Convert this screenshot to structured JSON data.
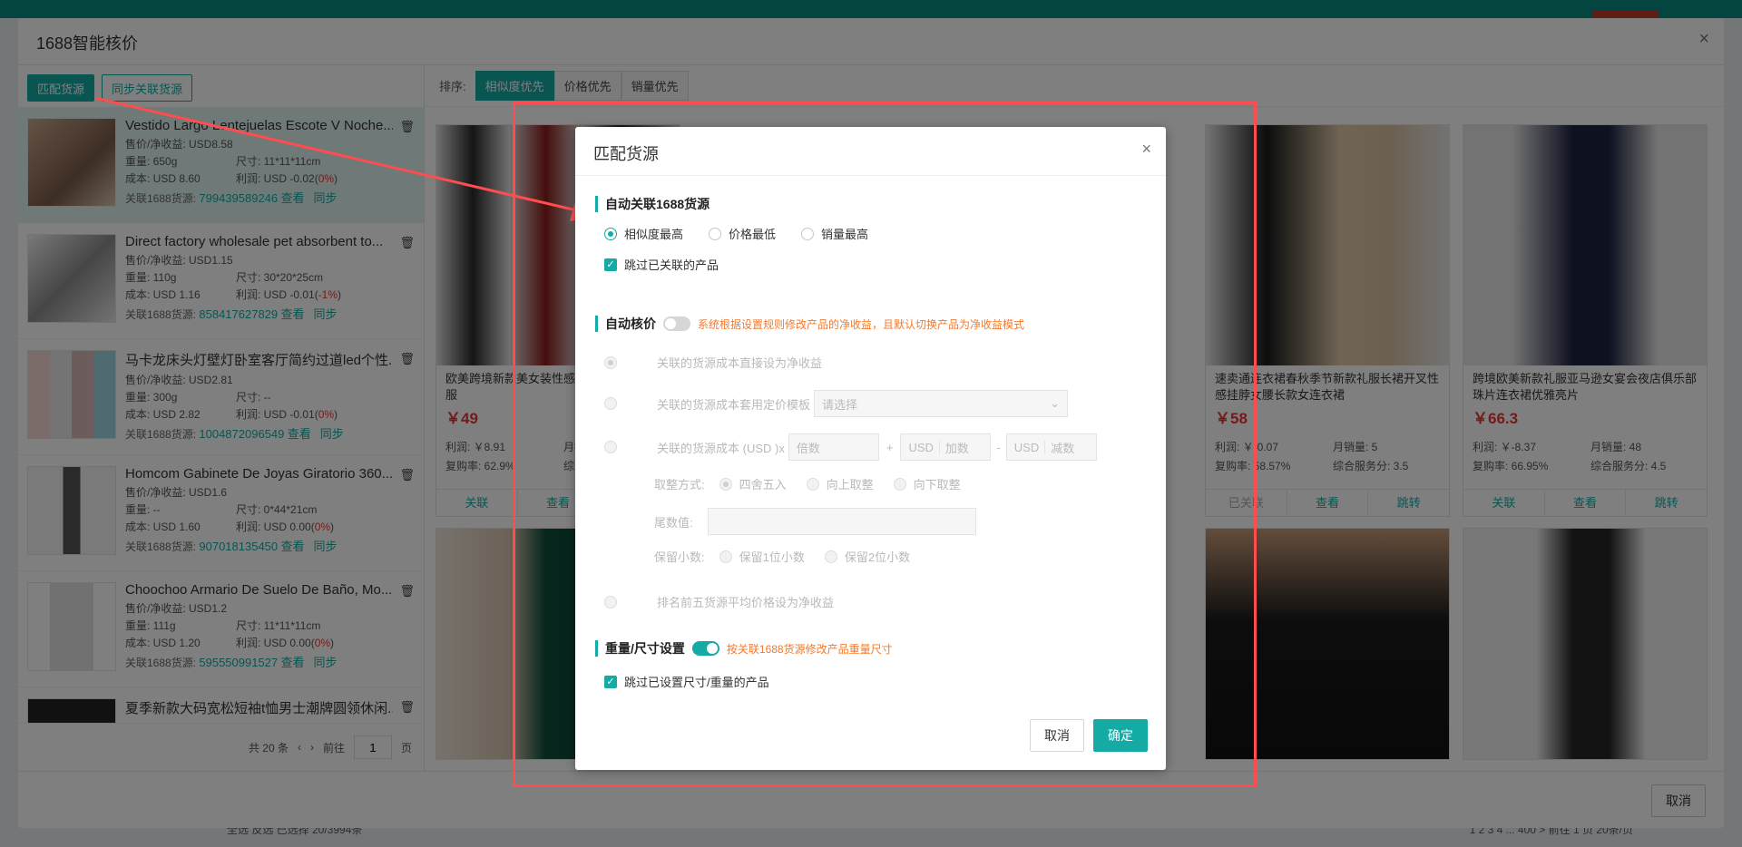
{
  "main": {
    "title": "1688智能核价",
    "buttons": {
      "match": "匹配货源",
      "sync": "同步关联货源"
    },
    "products": [
      {
        "title": "Vestido Largo Lentejuelas Escote V Noche...",
        "price": "售价/净收益:  USD8.58",
        "weight": "重量:  650g",
        "size": "尺寸:  11*11*11cm",
        "cost": "成本:  USD 8.60",
        "profit": "利润:  USD -0.02(",
        "pct": "0%",
        "close": ")",
        "link_label": "关联1688货源:",
        "link_id": "799439589246",
        "view": "查看",
        "sync": "同步"
      },
      {
        "title": "Direct factory wholesale pet absorbent to...",
        "price": "售价/净收益:  USD1.15",
        "weight": "重量:  110g",
        "size": "尺寸:  30*20*25cm",
        "cost": "成本:  USD 1.16",
        "profit": "利润:  USD -0.01(",
        "pct": "-1%",
        "close": ")",
        "link_label": "关联1688货源:",
        "link_id": "858417627829",
        "view": "查看",
        "sync": "同步"
      },
      {
        "title": "马卡龙床头灯壁灯卧室客厅简约过道led个性...",
        "price": "售价/净收益:  USD2.81",
        "weight": "重量:  300g",
        "size": "尺寸:  --",
        "cost": "成本:  USD 2.82",
        "profit": "利润:  USD -0.01(",
        "pct": "0%",
        "close": ")",
        "link_label": "关联1688货源:",
        "link_id": "1004872096549",
        "view": "查看",
        "sync": "同步"
      },
      {
        "title": "Homcom Gabinete De Joyas Giratorio 360...",
        "price": "售价/净收益:  USD1.6",
        "weight": "重量:  --",
        "size": "尺寸:  0*44*21cm",
        "cost": "成本:  USD 1.60",
        "profit": "利润:  USD 0.00(",
        "pct": "0%",
        "close": ")",
        "link_label": "关联1688货源:",
        "link_id": "907018135450",
        "view": "查看",
        "sync": "同步"
      },
      {
        "title": "Choochoo Armario De Suelo De Baño, Mo...",
        "price": "售价/净收益:  USD1.2",
        "weight": "重量:  111g",
        "size": "尺寸:  11*11*11cm",
        "cost": "成本:  USD 1.20",
        "profit": "利润:  USD 0.00(",
        "pct": "0%",
        "close": ")",
        "link_label": "关联1688货源:",
        "link_id": "595550991527",
        "view": "查看",
        "sync": "同步"
      },
      {
        "title": "夏季新款大码宽松短袖t恤男士潮牌圆领休闲...",
        "price": "",
        "weight": "",
        "size": "",
        "cost": "",
        "profit": "",
        "pct": "",
        "close": "",
        "link_label": "",
        "link_id": "",
        "view": "",
        "sync": ""
      }
    ],
    "pager": {
      "total": "共 20 条",
      "goto": "前往",
      "page": "1",
      "page_unit": "页"
    },
    "sort": {
      "label": "排序:",
      "options": [
        "相似度优先",
        "价格优先",
        "销量优先"
      ]
    },
    "cards": [
      {
        "title": "欧美跨境新款美女装性感片开叉礼服长晚礼服",
        "price": "￥49",
        "profit": "利润:  ￥8.91",
        "monthly": "月销",
        "repurchase": "复购率:  62.9%",
        "service": "综合",
        "a1": "关联",
        "a2": "查看",
        "a3": ""
      },
      {
        "title": "速卖通连衣裙春秋季节新款礼服长裙开叉性感挂脖女腰长款女连衣裙",
        "price": "￥58",
        "profit": "利润:  ￥-0.07",
        "monthly": "月销量:  5",
        "repurchase": "复购率:  58.57%",
        "service": "综合服务分:  3.5",
        "a1": "已关联",
        "a2": "查看",
        "a3": "跳转"
      },
      {
        "title": "跨境欧美新款礼服亚马逊女宴会夜店俱乐部珠片连衣裙优雅亮片",
        "price": "￥66.3",
        "profit": "利润:  ￥-8.37",
        "monthly": "月销量:  48",
        "repurchase": "复购率:  66.95%",
        "service": "综合服务分:  4.5",
        "a1": "关联",
        "a2": "查看",
        "a3": "跳转"
      }
    ],
    "cancel": "取消"
  },
  "background": {
    "bottom_text": "全选    反选    已选择 20/3994条",
    "pager_text": "1  2  3  4  ...  400  >  前往  1  页   20条/页"
  },
  "modal": {
    "title": "匹配货源",
    "sec1": "自动关联1688货源",
    "radio1": [
      "相似度最高",
      "价格最低",
      "销量最高"
    ],
    "skip_linked": "跳过已关联的产品",
    "sec2": "自动核价",
    "sec2_hint": "系统根据设置规则修改产品的净收益，且默认切换产品为净收益模式",
    "opt1": "关联的货源成本直接设为净收益",
    "opt2": "关联的货源成本套用定价模板",
    "opt2_placeholder": "请选择",
    "opt3": "关联的货源成本 (USD )x",
    "opt3_mult": "倍数",
    "opt3_plus": "+",
    "opt3_usd": "USD",
    "opt3_add": "加数",
    "opt3_minus": "-",
    "opt3_sub": "减数",
    "rounding_label": "取整方式:",
    "rounding": [
      "四舍五入",
      "向上取整",
      "向下取整"
    ],
    "tail_label": "尾数值:",
    "decimals_label": "保留小数:",
    "decimals": [
      "保留1位小数",
      "保留2位小数"
    ],
    "opt4": "排名前五货源平均价格设为净收益",
    "sec3": "重量/尺寸设置",
    "sec3_hint": "按关联1688货源修改产品重量尺寸",
    "skip_size": "跳过已设置尺寸/重量的产品",
    "cancel": "取消",
    "ok": "确定"
  },
  "colors": {
    "accent": "#13aba3",
    "warn": "#f5792a",
    "price": "#e53935",
    "annotation": "#ff4d4f"
  },
  "icons": [
    "close-icon",
    "trash-icon",
    "chevron-left-icon",
    "chevron-right-icon",
    "chevron-down-icon",
    "check-icon",
    "arrow-annotation"
  ]
}
